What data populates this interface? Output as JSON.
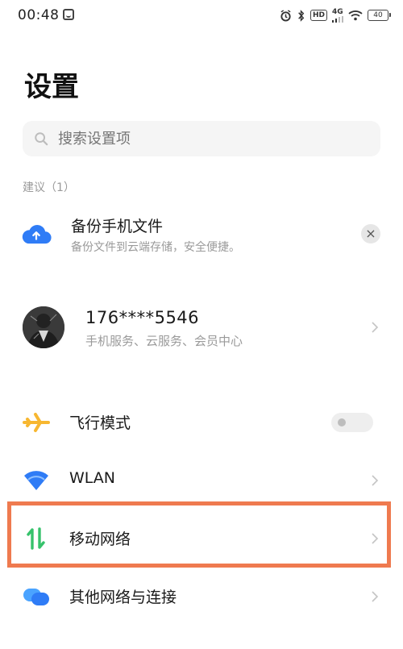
{
  "status_bar": {
    "time": "00:48",
    "hd": "HD",
    "network": "4G",
    "battery": "40"
  },
  "title": "设置",
  "search": {
    "placeholder": "搜索设置项"
  },
  "suggestions": {
    "header": "建议（1）",
    "item": {
      "title": "备份手机文件",
      "subtitle": "备份文件到云端存储，安全便捷。",
      "icon": "cloud-upload-icon",
      "dismiss": "×"
    }
  },
  "account": {
    "name": "176****5546",
    "subtitle": "手机服务、云服务、会员中心"
  },
  "settings": [
    {
      "label": "飞行模式",
      "icon": "airplane-icon",
      "toggle": false
    },
    {
      "label": "WLAN",
      "icon": "wifi-icon"
    },
    {
      "label": "移动网络",
      "icon": "mobile-data-icon",
      "highlighted": true
    },
    {
      "label": "其他网络与连接",
      "icon": "connections-icon"
    }
  ],
  "colors": {
    "accent_blue": "#2f7cf6",
    "airplane": "#f7b731",
    "mobile_data": "#36c26b",
    "highlight_border": "#ef7a4f"
  }
}
